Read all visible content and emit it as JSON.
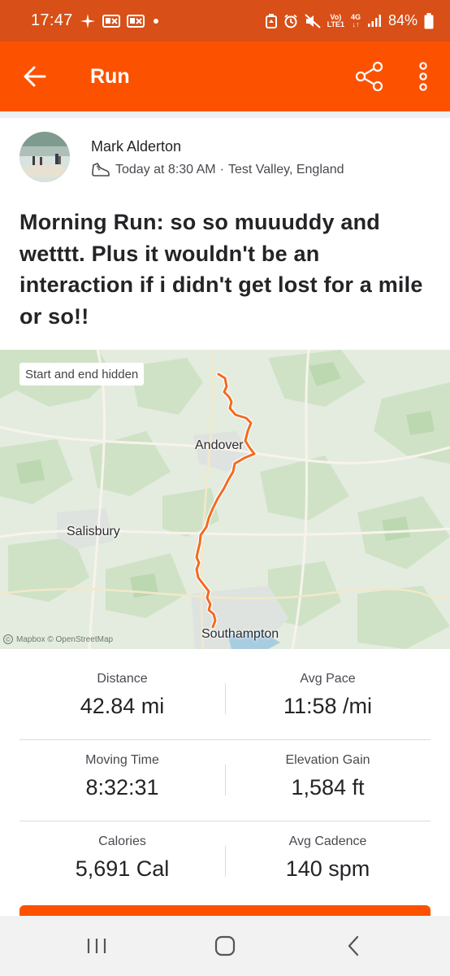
{
  "status_bar": {
    "time": "17:47",
    "network": {
      "top": "Vo)",
      "bottom": "LTE1"
    },
    "data": {
      "top": "4G",
      "bottom": ""
    },
    "battery": "84%"
  },
  "app_bar": {
    "title": "Run",
    "icons": {
      "back": "arrow-left-icon",
      "share": "share-icon",
      "more": "more-vertical-icon"
    }
  },
  "activity": {
    "athlete_name": "Mark Alderton",
    "time": "Today at 8:30 AM",
    "separator": "·",
    "location": "Test Valley, England",
    "title": "Morning Run: so so muuuddy and wetttt. Plus it wouldn't be an interaction if i didn't get lost for a mile or so!!"
  },
  "map": {
    "privacy_chip": "Start and end hidden",
    "places": [
      "Andover",
      "Salisbury",
      "Southampton"
    ],
    "attribution": {
      "symbol": "©",
      "text": "Mapbox © OpenStreetMap"
    },
    "route_color": "#f26a21"
  },
  "stats": [
    {
      "label": "Distance",
      "value": "42.84 mi"
    },
    {
      "label": "Avg Pace",
      "value": "11:58 /mi"
    },
    {
      "label": "Moving Time",
      "value": "8:32:31"
    },
    {
      "label": "Elevation Gain",
      "value": "1,584 ft"
    },
    {
      "label": "Calories",
      "value": "5,691 Cal"
    },
    {
      "label": "Avg Cadence",
      "value": "140 spm"
    }
  ],
  "nav_bar": {
    "icons": [
      "recent-apps-icon",
      "home-icon",
      "back-icon"
    ]
  },
  "colors": {
    "brand": "#fc5200",
    "status_bar": "#d84f17"
  }
}
